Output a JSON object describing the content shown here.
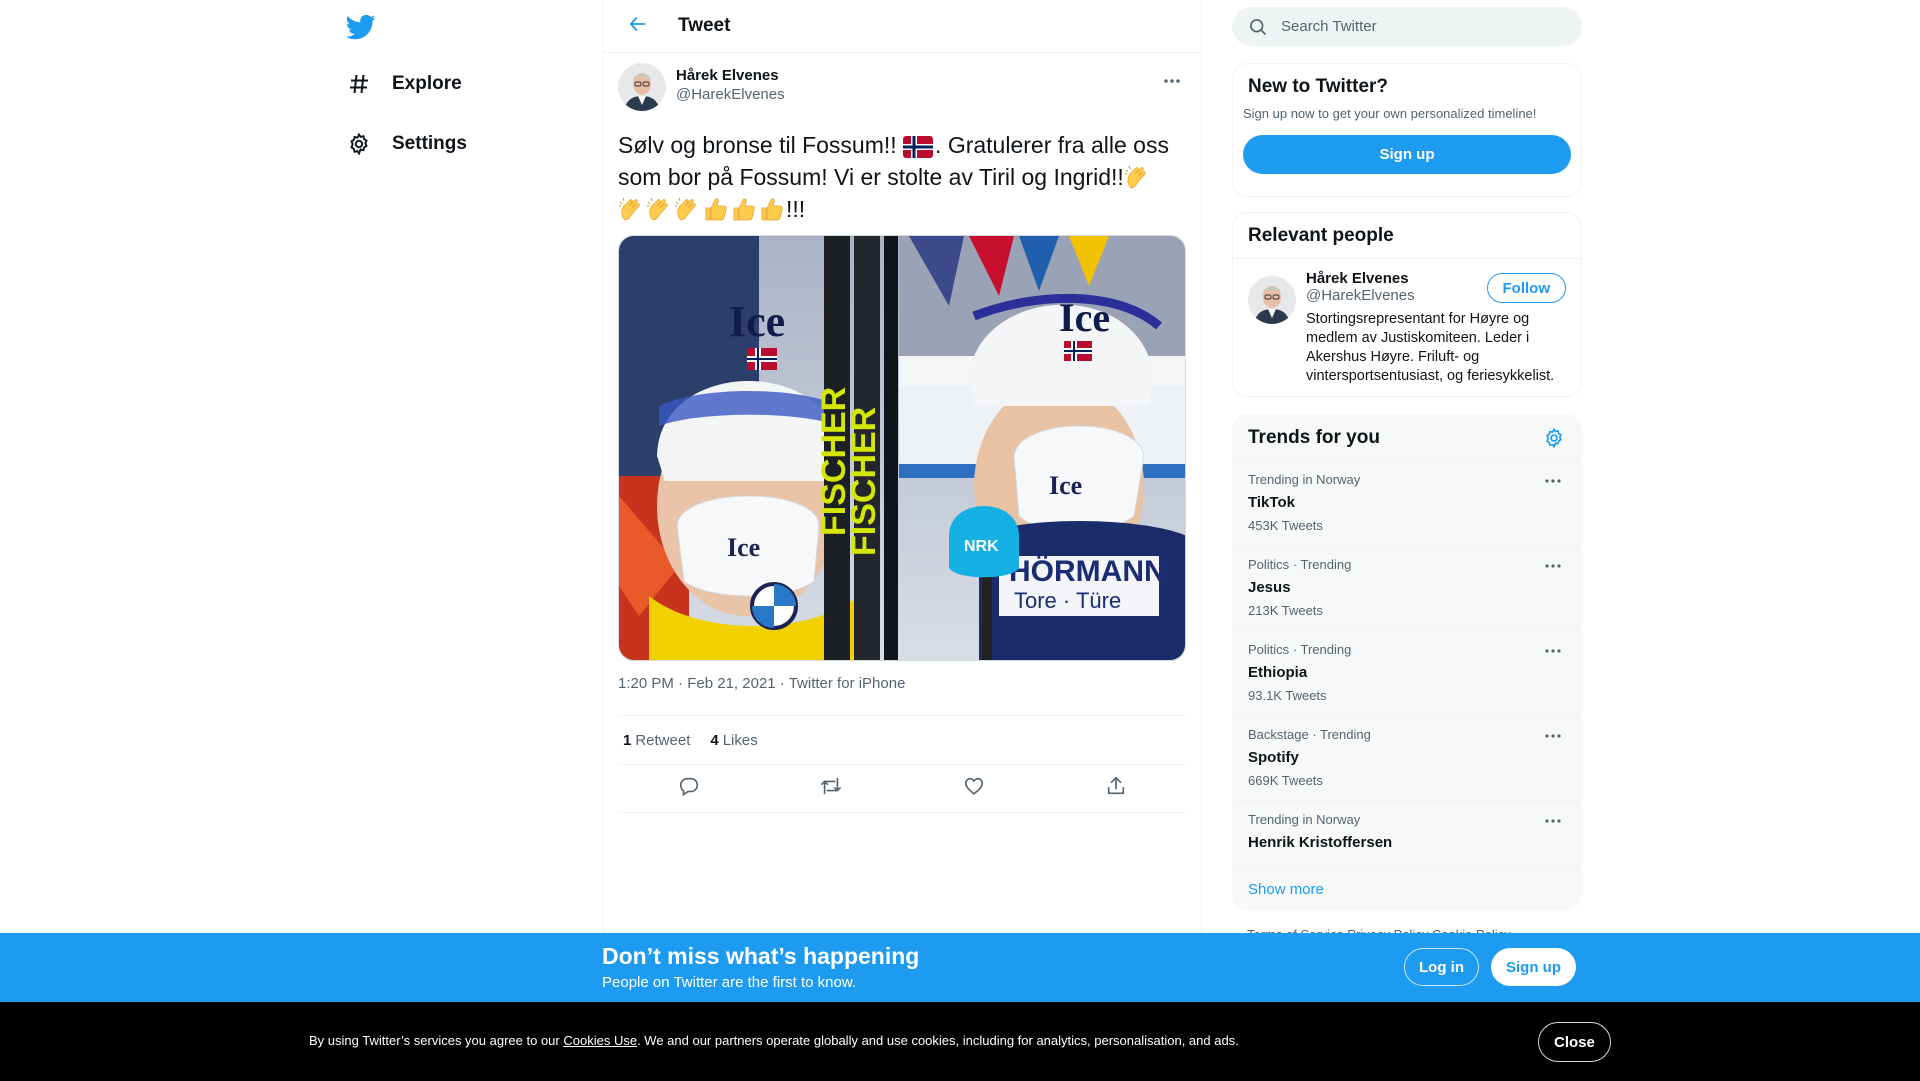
{
  "colors": {
    "accent": "#1d9bf0",
    "text": "#0f1419",
    "secondary": "#536471",
    "cookie_bg": "#000000"
  },
  "nav": {
    "logo_icon": "twitter-bird-icon",
    "items": [
      {
        "label": "Explore",
        "icon": "hashtag-icon"
      },
      {
        "label": "Settings",
        "icon": "gear-icon"
      }
    ]
  },
  "header": {
    "title": "Tweet",
    "back_icon": "arrow-left-icon"
  },
  "tweet": {
    "author_name": "Hårek Elvenes",
    "author_handle": "@HarekElvenes",
    "text_part1": "Sølv og bronse til Fossum!! ",
    "text_part2": ". Gratulerer fra alle oss som bor på Fossum! Vi er stolte av Tiril og Ingrid!!",
    "text_part3": "!!!",
    "emoji": [
      "flag-norway",
      "clapping-hands",
      "clapping-hands",
      "clapping-hands",
      "clapping-hands",
      "thumbs-up",
      "thumbs-up",
      "thumbs-up"
    ],
    "image_text": {
      "cap1": "Ice",
      "cap2": "Ice",
      "mask1": "Ice",
      "mask2": "Ice",
      "ski_brand": "FISCHER",
      "mic": "NRK",
      "bib_brand": "HÖRMANN",
      "bib_sub": "Tore · Türe"
    },
    "time": "1:20 PM",
    "date": "Feb 21, 2021",
    "source": "Twitter for iPhone",
    "separator": "·",
    "retweets_count": "1",
    "retweets_label": "Retweet",
    "likes_count": "4",
    "likes_label": "Likes"
  },
  "search": {
    "placeholder": "Search Twitter"
  },
  "new_to_twitter": {
    "title": "New to Twitter?",
    "subtitle": "Sign up now to get your own personalized timeline!",
    "button": "Sign up"
  },
  "relevant_people": {
    "title": "Relevant people",
    "person": {
      "name": "Hårek Elvenes",
      "handle": "@HarekElvenes",
      "bio": "Stortingsrepresentant for Høyre og medlem av Justiskomiteen. Leder i Akershus Høyre. Friluft- og vintersportsentusiast, og feriesykkelist.",
      "follow_label": "Follow"
    }
  },
  "trends": {
    "title": "Trends for you",
    "items": [
      {
        "context": "Trending in Norway",
        "name": "TikTok",
        "count": "453K Tweets"
      },
      {
        "context": "Politics · Trending",
        "name": "Jesus",
        "count": "213K Tweets"
      },
      {
        "context": "Politics · Trending",
        "name": "Ethiopia",
        "count": "93.1K Tweets"
      },
      {
        "context": "Backstage · Trending",
        "name": "Spotify",
        "count": "669K Tweets"
      },
      {
        "context": "Trending in Norway",
        "name": "Henrik Kristoffersen",
        "count": ""
      }
    ],
    "show_more": "Show more"
  },
  "footer_links": "Terms of Service   Privacy Policy   Cookie Policy",
  "banner": {
    "title": "Don’t miss what’s happening",
    "subtitle": "People on Twitter are the first to know.",
    "login": "Log in",
    "signup": "Sign up"
  },
  "cookie": {
    "text_before": "By using Twitter’s services you agree to our ",
    "link": "Cookies Use",
    "text_after": ". We and our partners operate globally and use cookies, including for analytics, personalisation, and ads.",
    "close": "Close"
  }
}
